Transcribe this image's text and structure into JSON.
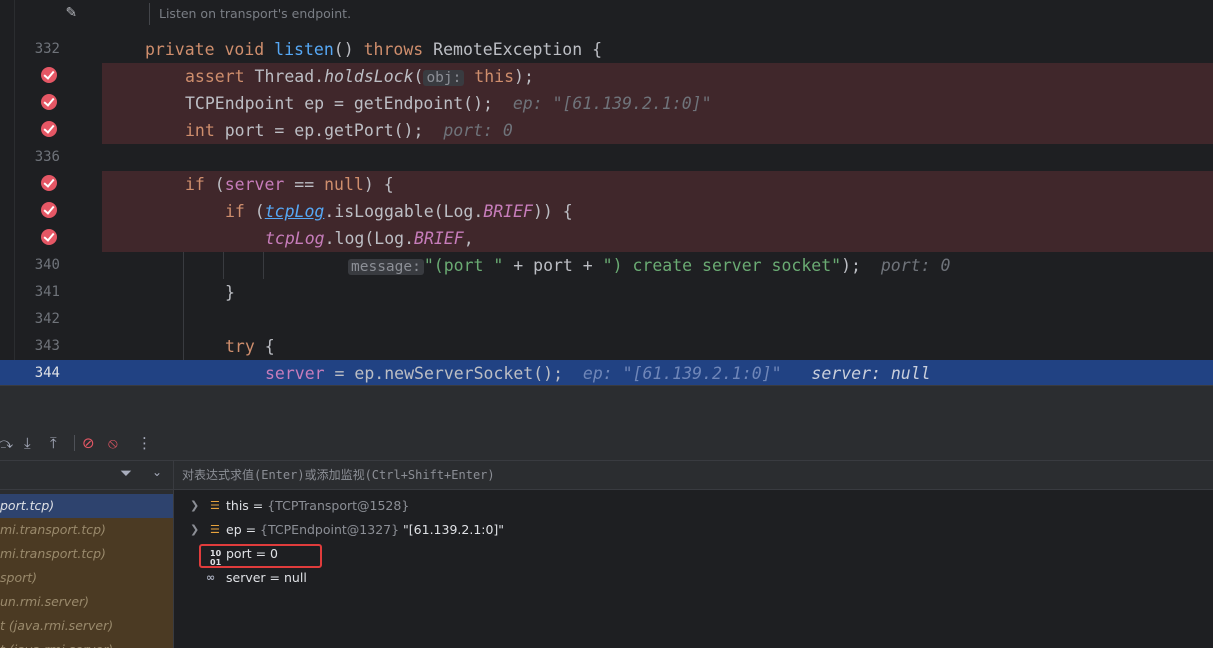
{
  "editor": {
    "doc_comment": "Listen on transport's endpoint.",
    "lines": {
      "l332": {
        "num": "332"
      },
      "l336": {
        "num": "336"
      },
      "l340": {
        "num": "340"
      },
      "l341": {
        "num": "341"
      },
      "l342": {
        "num": "342"
      },
      "l343": {
        "num": "343"
      },
      "l344": {
        "num": "344"
      }
    },
    "code": {
      "c332_kw1": "private",
      "c332_kw2": "void",
      "c332_fn": "listen",
      "c332_paren": "() ",
      "c332_kw3": "throws",
      "c332_rest": " RemoteException {",
      "c333_kw": "assert",
      "c333_a": " Thread.",
      "c333_m": "holdsLock",
      "c333_b": "(",
      "c333_hint": "obj:",
      "c333_this": "this",
      "c333_c": ");",
      "c334": "TCPEndpoint ep = getEndpoint();",
      "c334_inline": "ep: \"[61.139.2.1:0]\"",
      "c335_kw": "int",
      "c335": " port = ep.getPort();",
      "c335_inline": "port: 0",
      "c337_kw": "if",
      "c337_a": " (",
      "c337_field": "server",
      "c337_b": " == ",
      "c337_null": "null",
      "c337_c": ") {",
      "c338_kw": "if",
      "c338_a": " (",
      "c338_link": "tcpLog",
      "c338_b": ".isLoggable(Log.",
      "c338_const": "BRIEF",
      "c338_c": ")) {",
      "c339_link": "tcpLog",
      "c339_a": ".log(Log.",
      "c339_const": "BRIEF",
      "c339_b": ",",
      "c340_hint": "message:",
      "c340_str1": "\"(port \"",
      "c340_a": " + port + ",
      "c340_str2": "\") create server socket\"",
      "c340_b": ");",
      "c340_inline": "port: 0",
      "c341": "}",
      "c343_kw": "try",
      "c343": " {",
      "c344_field": "server",
      "c344": " = ep.newServerSocket();",
      "c344_inline1": "ep: \"[61.139.2.1:0]\"",
      "c344_inline2": "server: null"
    }
  },
  "debugger": {
    "eval_placeholder": "对表达式求值(Enter)或添加监视(Ctrl+Shift+Enter)",
    "frames": [
      {
        "label": "port.tcp)"
      },
      {
        "label": "mi.transport.tcp)"
      },
      {
        "label": "mi.transport.tcp)"
      },
      {
        "label": "sport)"
      },
      {
        "label": "un.rmi.server)"
      },
      {
        "label": "t (java.rmi.server)"
      },
      {
        "label": "t (java.rmi.server)"
      }
    ],
    "variables": [
      {
        "name": "this",
        "eq": " = ",
        "type": "{TCPTransport@1528}",
        "value": ""
      },
      {
        "name": "ep",
        "eq": " = ",
        "type": "{TCPEndpoint@1327}",
        "value": " \"[61.139.2.1:0]\""
      },
      {
        "name": "port",
        "eq": " = ",
        "type": "",
        "value": "0"
      },
      {
        "name": "server",
        "eq": " = ",
        "type": "",
        "value": "null"
      }
    ]
  },
  "colors": {
    "breakpoint_line": "#40272b",
    "current_line": "#214283",
    "breakpoint_dot": "#e55765",
    "highlight_box": "#e03c3c"
  }
}
